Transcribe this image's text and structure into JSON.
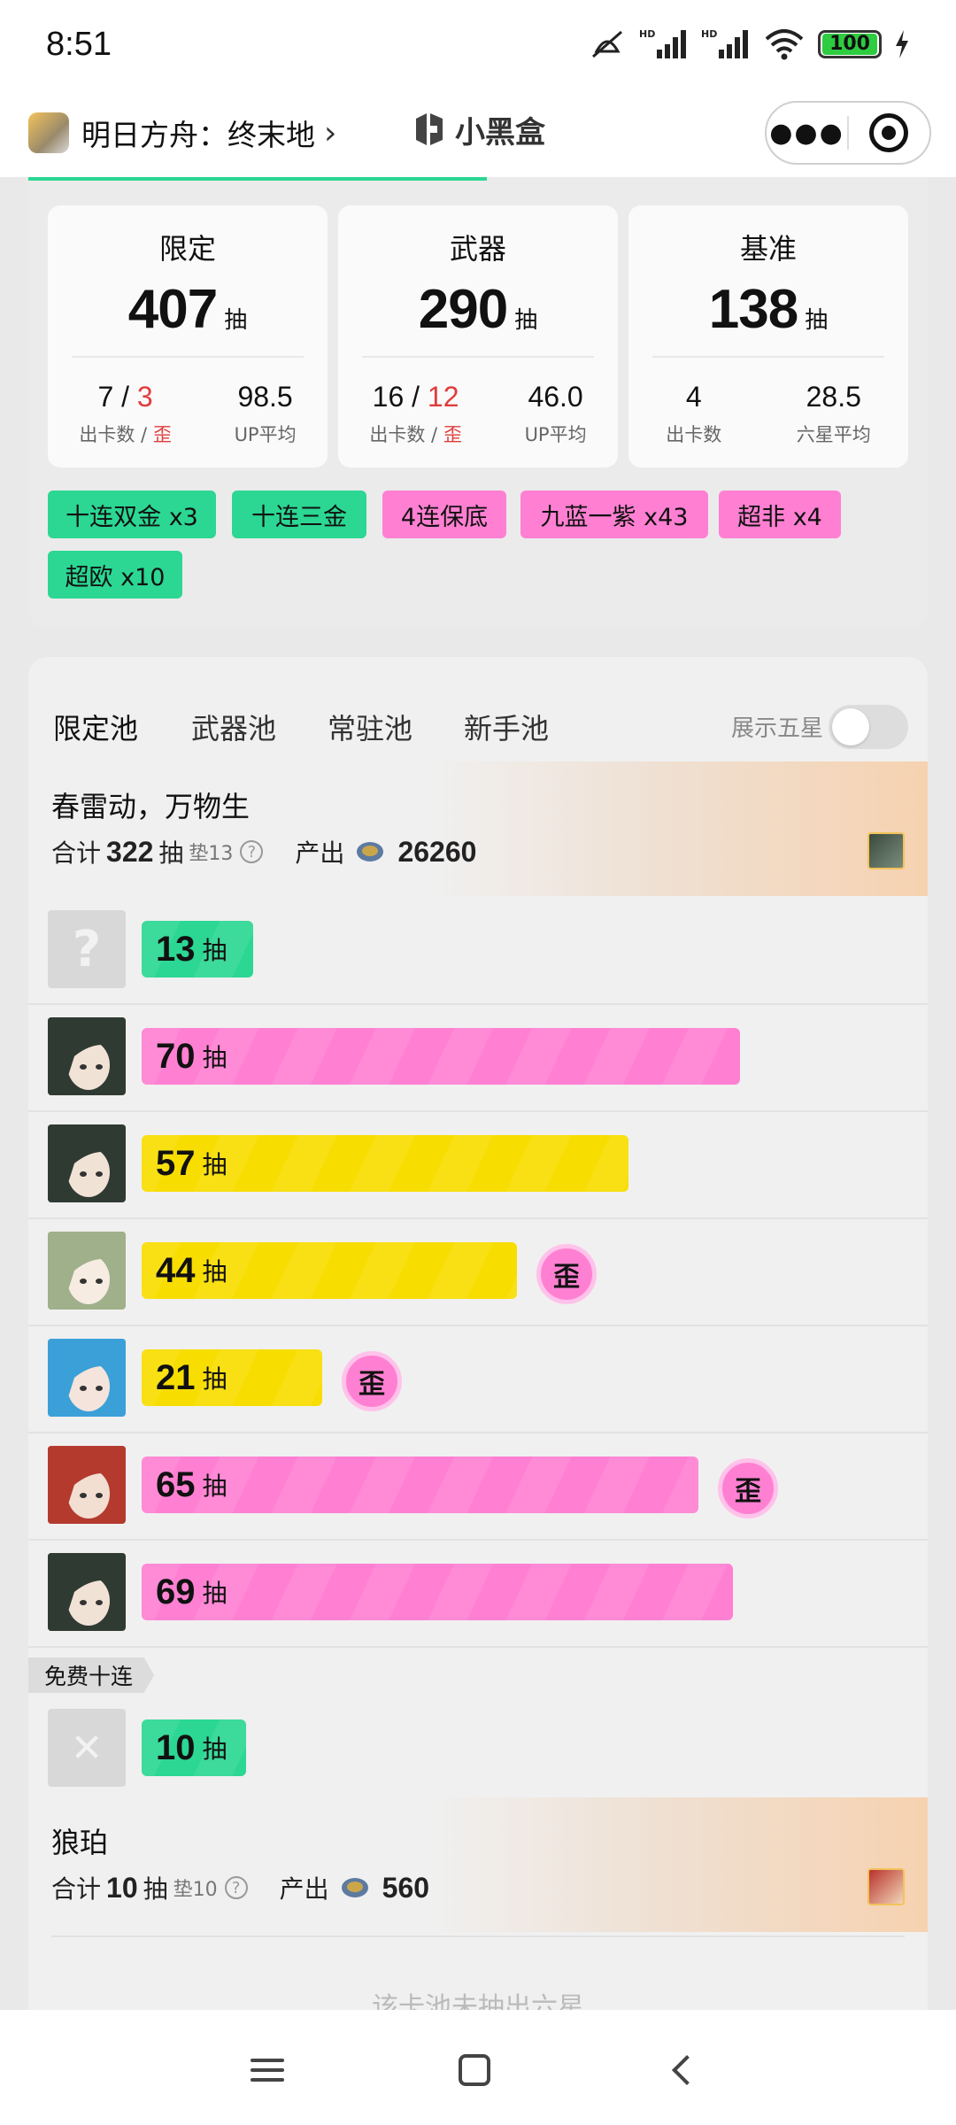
{
  "status": {
    "time": "8:51",
    "battery": "100"
  },
  "header": {
    "app_title": "明日方舟：终末地",
    "brand": "小黑盒"
  },
  "summary": {
    "cards": [
      {
        "title": "限定",
        "total": "407",
        "unit": "抽",
        "left_value_a": "7",
        "left_value_sep": " / ",
        "left_value_b": "3",
        "left_label_a": "出卡数 / ",
        "left_label_b": "歪",
        "right_value": "98.5",
        "right_label": "UP平均"
      },
      {
        "title": "武器",
        "total": "290",
        "unit": "抽",
        "left_value_a": "16",
        "left_value_sep": " / ",
        "left_value_b": "12",
        "left_label_a": "出卡数 / ",
        "left_label_b": "歪",
        "right_value": "46.0",
        "right_label": "UP平均"
      },
      {
        "title": "基准",
        "total": "138",
        "unit": "抽",
        "left_value_a": "4",
        "left_value_sep": "",
        "left_value_b": "",
        "left_label_a": "出卡数",
        "left_label_b": "",
        "right_value": "28.5",
        "right_label": "六星平均"
      }
    ],
    "tags": [
      {
        "label": "十连双金 x3",
        "color": "green"
      },
      {
        "label": "十连三金",
        "color": "green"
      },
      {
        "label": "4连保底",
        "color": "pink"
      },
      {
        "label": "九蓝一紫 x43",
        "color": "pink"
      },
      {
        "label": "超非 x4",
        "color": "pink"
      },
      {
        "label": "超欧 x10",
        "color": "green"
      }
    ]
  },
  "pools": {
    "tabs": [
      "限定池",
      "武器池",
      "常驻池",
      "新手池"
    ],
    "active_tab": 0,
    "show_five_label": "展示五星",
    "show_five_enabled": false,
    "banner1": {
      "name": "春雷动，万物生",
      "total_prefix": "合计",
      "total": "322",
      "unit": "抽",
      "pad": "垫13",
      "output_label": "产出",
      "output": "26260"
    },
    "pulls": [
      {
        "count": "13",
        "unit": "抽",
        "color": "green",
        "fill": 0.16,
        "wai": false,
        "avatar": "unknown"
      },
      {
        "count": "70",
        "unit": "抽",
        "color": "pink",
        "fill": 0.86,
        "wai": false,
        "avatar": "dark-hair"
      },
      {
        "count": "57",
        "unit": "抽",
        "color": "yellow",
        "fill": 0.7,
        "wai": false,
        "avatar": "dark-hair"
      },
      {
        "count": "44",
        "unit": "抽",
        "color": "yellow",
        "fill": 0.54,
        "wai": true,
        "avatar": "green-hair"
      },
      {
        "count": "21",
        "unit": "抽",
        "color": "yellow",
        "fill": 0.26,
        "wai": true,
        "avatar": "blue-hair"
      },
      {
        "count": "65",
        "unit": "抽",
        "color": "pink",
        "fill": 0.8,
        "wai": true,
        "avatar": "red-hair"
      },
      {
        "count": "69",
        "unit": "抽",
        "color": "pink",
        "fill": 0.85,
        "wai": false,
        "avatar": "dark-hair"
      }
    ],
    "wai_label": "歪",
    "free_ten_label": "免费十连",
    "free_pull": {
      "count": "10",
      "unit": "抽",
      "color": "green",
      "fill": 0.15
    },
    "banner2": {
      "name": "狼珀",
      "total_prefix": "合计",
      "total": "10",
      "unit": "抽",
      "pad": "垫10",
      "output_label": "产出",
      "output": "560"
    },
    "footer_hint": "该卡池未抽出六星"
  },
  "colors": {
    "green": "#2bd793",
    "pink": "#ff80d2",
    "yellow": "#f7dd00",
    "wai_red": "#e03c3c"
  }
}
